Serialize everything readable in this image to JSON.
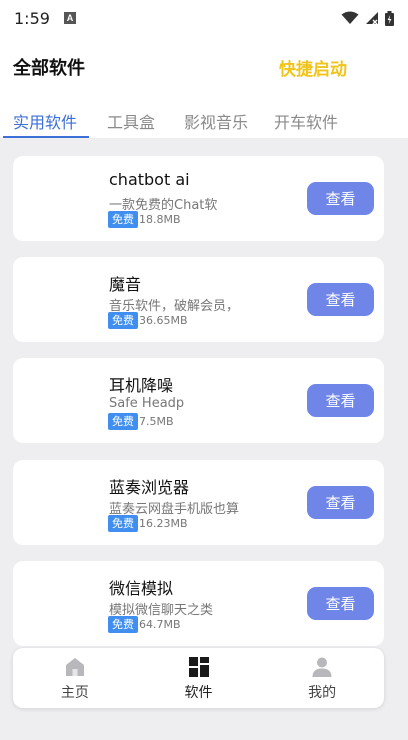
{
  "status_bar": {
    "time": "1:59"
  },
  "header": {
    "title": "全部软件",
    "quick_launch": "快捷启动"
  },
  "tabs": [
    {
      "label": "实用软件"
    },
    {
      "label": "工具盒"
    },
    {
      "label": "影视音乐"
    },
    {
      "label": "开车软件"
    }
  ],
  "apps": [
    {
      "name": "chatbot ai",
      "desc": "一款免费的Chat软",
      "badge": "免费",
      "size": "18.8MB",
      "button": "查看"
    },
    {
      "name": "魔音",
      "desc": "音乐软件，破解会员，",
      "badge": "免费",
      "size": "36.65MB",
      "button": "查看"
    },
    {
      "name": "耳机降噪",
      "desc": "Safe Headp",
      "badge": "免费",
      "size": "7.5MB",
      "button": "查看"
    },
    {
      "name": "蓝奏浏览器",
      "desc": "蓝奏云网盘手机版也算",
      "badge": "免费",
      "size": "16.23MB",
      "button": "查看"
    },
    {
      "name": "微信模拟",
      "desc": "模拟微信聊天之类",
      "badge": "免费",
      "size": "64.7MB",
      "button": "查看"
    }
  ],
  "bottom_nav": [
    {
      "label": "主页",
      "icon": "home-icon"
    },
    {
      "label": "软件",
      "icon": "apps-grid-icon"
    },
    {
      "label": "我的",
      "icon": "user-icon"
    }
  ],
  "colors": {
    "accent": "#3d6fd8",
    "quick_launch": "#f0c419",
    "view_button": "#6f86e8",
    "free_badge": "#3f8ef0"
  }
}
